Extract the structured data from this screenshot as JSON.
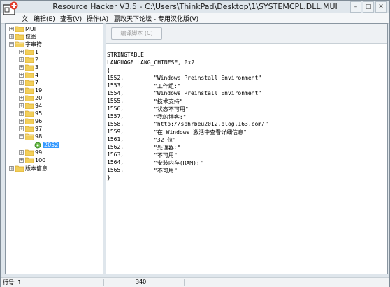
{
  "window": {
    "title": "Resource Hacker V3.5  -  C:\\Users\\ThinkPad\\Desktop\\1\\SYSTEMCPL.DLL.MUI"
  },
  "menu": [
    {
      "label": "文"
    },
    {
      "label": "编辑(E)"
    },
    {
      "label": "查看(V)"
    },
    {
      "label": "操作(A)"
    },
    {
      "label": "赢政天下论坛 - 专用汉化版(V)"
    }
  ],
  "tree": {
    "root": [
      {
        "label": "MUI",
        "expanded": false
      },
      {
        "label": "位图",
        "expanded": false
      },
      {
        "label": "字串符",
        "expanded": true
      }
    ],
    "string_children": [
      "1",
      "2",
      "3",
      "4",
      "7",
      "19",
      "20",
      "94",
      "95",
      "96",
      "97",
      "98"
    ],
    "leaf_2052": "2052",
    "after_98": [
      "99",
      "100"
    ],
    "version_info": "版本信息"
  },
  "toolbar": {
    "compile_label": "编译脚本 (C)"
  },
  "editor": {
    "header": [
      "STRINGTABLE",
      "LANGUAGE LANG_CHINESE, 0x2",
      "{"
    ],
    "entries": [
      {
        "id": "1552,",
        "text": "\"Windows Preinstall Environment\""
      },
      {
        "id": "1553,",
        "text": "\"工作组:\""
      },
      {
        "id": "1554,",
        "text": "\"Windows Preinstall Environment\""
      },
      {
        "id": "1555,",
        "text": "\"技术支持\""
      },
      {
        "id": "1556,",
        "text": "\"状态不可用\""
      },
      {
        "id": "1557,",
        "text": "\"我的博客:\""
      },
      {
        "id": "1558,",
        "text": "\"http://sphrbeu2012.blog.163.com/\""
      },
      {
        "id": "1559,",
        "text": "\"在 Windows 激活中查看详细信息\""
      },
      {
        "id": "1561,",
        "text": "\"32 位\""
      },
      {
        "id": "1562,",
        "text": "\"处理器:\""
      },
      {
        "id": "1563,",
        "text": "\"不可用\""
      },
      {
        "id": "1564,",
        "text": "\"安装内存(RAM):\""
      },
      {
        "id": "1565,",
        "text": "\"不可用\""
      }
    ],
    "footer": "}"
  },
  "status": {
    "line_label": "行号: 1",
    "count": "340"
  },
  "colors": {
    "selection": "#3399ff",
    "folder": "#f2cf5b",
    "folder_dark": "#d9a928",
    "icon_red": "#e23b2b"
  }
}
